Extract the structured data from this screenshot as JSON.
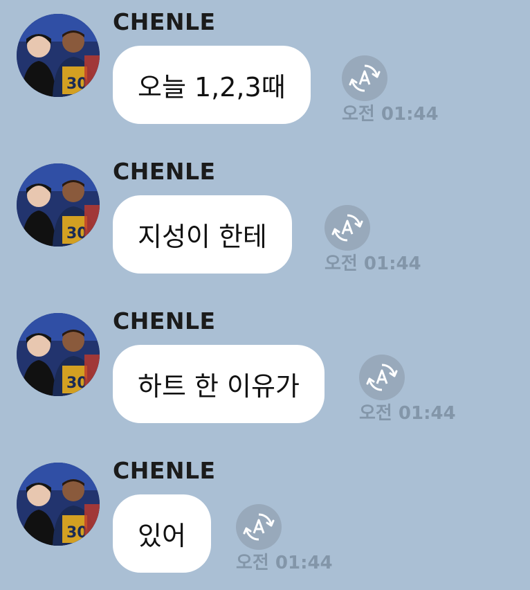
{
  "colors": {
    "background": "#aabfd4",
    "bubble": "#ffffff",
    "timestamp": "#8396a9",
    "translate_button": "#98a9bb"
  },
  "messages": [
    {
      "sender": "CHENLE",
      "text": "오늘 1,2,3때",
      "time": "오전 01:44",
      "avatar_icon": "profile-photo",
      "action_icon": "auto-translate-icon"
    },
    {
      "sender": "CHENLE",
      "text": "지성이 한테",
      "time": "오전 01:44",
      "avatar_icon": "profile-photo",
      "action_icon": "auto-translate-icon"
    },
    {
      "sender": "CHENLE",
      "text": "하트 한 이유가",
      "time": "오전 01:44",
      "avatar_icon": "profile-photo",
      "action_icon": "auto-translate-icon"
    },
    {
      "sender": "CHENLE",
      "text": "있어",
      "time": "오전 01:44",
      "avatar_icon": "profile-photo",
      "action_icon": "auto-translate-icon"
    }
  ]
}
